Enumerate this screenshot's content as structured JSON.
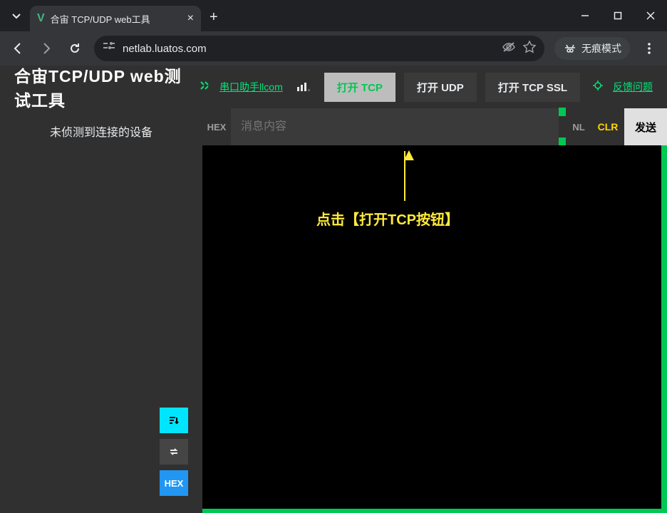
{
  "browser": {
    "tab_title": "合宙 TCP/UDP web工具",
    "url": "netlab.luatos.com",
    "incognito_label": "无痕模式"
  },
  "header": {
    "app_title": "合宙TCP/UDP web测试工具",
    "serial_link": "串口助手llcom",
    "open_tcp": "打开 TCP",
    "open_udp": "打开 UDP",
    "open_tcp_ssl": "打开 TCP SSL",
    "feedback": "反馈问题"
  },
  "sidebar": {
    "no_device": "未侦测到连接的设备",
    "hex_btn": "HEX"
  },
  "input": {
    "hex_label": "HEX",
    "placeholder": "消息内容",
    "nl_label": "NL",
    "clr_label": "CLR",
    "send_label": "发送"
  },
  "annotation": {
    "text": "点击【打开TCP按钮】"
  }
}
